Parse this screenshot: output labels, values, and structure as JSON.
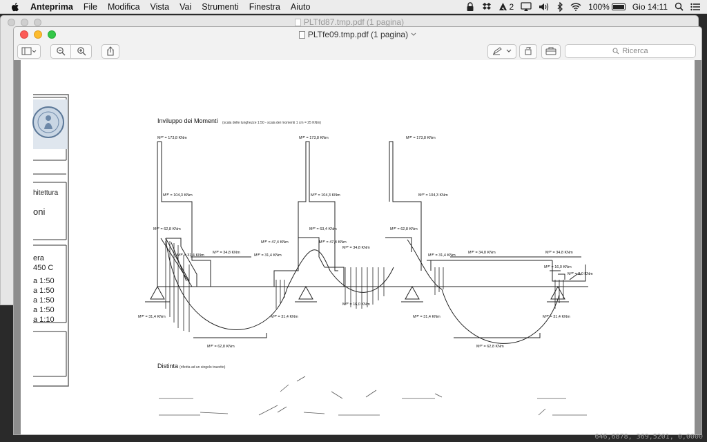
{
  "menubar": {
    "app": "Anteprima",
    "items": [
      "File",
      "Modifica",
      "Vista",
      "Vai",
      "Strumenti",
      "Finestra",
      "Aiuto"
    ],
    "badge": "2",
    "battery": "100%",
    "battery_level": 1.0,
    "clock": "Gio 14:11"
  },
  "bg_window": {
    "title": "PLTfd87.tmp.pdf (1 pagina)"
  },
  "window": {
    "title": "PLTfe09.tmp.pdf (1 pagina)"
  },
  "toolbar": {
    "search_placeholder": "Ricerca"
  },
  "drawing": {
    "title": "Inviluppo dei Momenti",
    "title_note": "(scala delle lunghezze 1:50 - scala dei momenti 1 cm = 25 KNm)",
    "distinta_title": "Distinta",
    "distinta_note": "(riferita ad un singolo travetto)",
    "cartouche": {
      "faculty": "hitettura",
      "name": "oni",
      "line1": "era",
      "line2": "450 C",
      "scales": [
        "a 1:50",
        "a 1:50",
        "a 1:50",
        "a 1:50",
        "a 1:10"
      ]
    },
    "labels": {
      "m_top": "Mᵈᴾ = 173,8 KNm",
      "m_104": "Mᵈᴾ = 104,3 KNm",
      "m_628": "Mᵈᴾ = 62,8 KNm",
      "m_634": "Mᵈᴾ = 63,4 KNm",
      "m_474": "Mᵈᴾ = 47,4 KNm",
      "m_314": "Mᵈᴾ = 31,4 KNm",
      "m_348": "Mᵈᴾ = 34,8 KNm",
      "m_160": "Mᵈᴾ = 16,0 KNm",
      "m_80": "Mᵈᴾ = 8,0 KNm"
    }
  },
  "status": {
    "coords": "646,6878, 369,5201, 0,0000"
  }
}
